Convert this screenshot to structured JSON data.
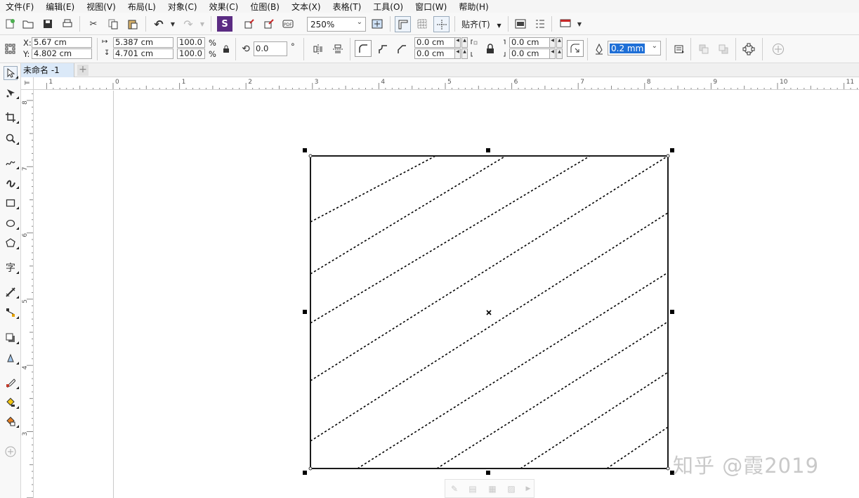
{
  "menu": [
    "文件(F)",
    "编辑(E)",
    "视图(V)",
    "布局(L)",
    "对象(C)",
    "效果(C)",
    "位图(B)",
    "文本(X)",
    "表格(T)",
    "工具(O)",
    "窗口(W)",
    "帮助(H)"
  ],
  "standard_toolbar": {
    "zoom": "250%",
    "snap_label": "贴齐(T)"
  },
  "property_bar": {
    "x_label": "X:",
    "x_value": "5.67 cm",
    "y_label": "Y:",
    "y_value": "4.802 cm",
    "width_value": "5.387 cm",
    "height_value": "4.701 cm",
    "scale_x": "100.0",
    "scale_y": "100.0",
    "percent": "%",
    "rotation": "0.0",
    "degree": "°",
    "corner_tl": "0.0 cm",
    "corner_bl": "0.0 cm",
    "corner_tr": "0.0 cm",
    "corner_br": "0.0 cm",
    "outline_width": "0.2 mm"
  },
  "document_tab": "未命名 -1",
  "ruler": {
    "horizontal": [
      "1",
      "0",
      "1",
      "2",
      "3",
      "4",
      "5",
      "6",
      "7",
      "8",
      "9",
      "10",
      "11"
    ],
    "vertical": [
      "8",
      "7",
      "6",
      "5",
      "4",
      "3"
    ]
  },
  "watermark": "知乎 @霞2019",
  "colors": {
    "selection": "#000000",
    "hatch": "#000000",
    "tab_active": "#dbe9f8"
  },
  "icons": [
    "new-icon",
    "open-icon",
    "save-icon",
    "print-icon",
    "cut-icon",
    "copy-icon",
    "paste-icon",
    "undo-icon",
    "redo-icon",
    "search-content-icon",
    "import-icon",
    "export-icon",
    "publish-pdf-icon",
    "full-screen-icon",
    "rulers-icon",
    "grid-icon",
    "guidelines-icon",
    "welcome-icon",
    "options-icon",
    "launch-icon"
  ]
}
